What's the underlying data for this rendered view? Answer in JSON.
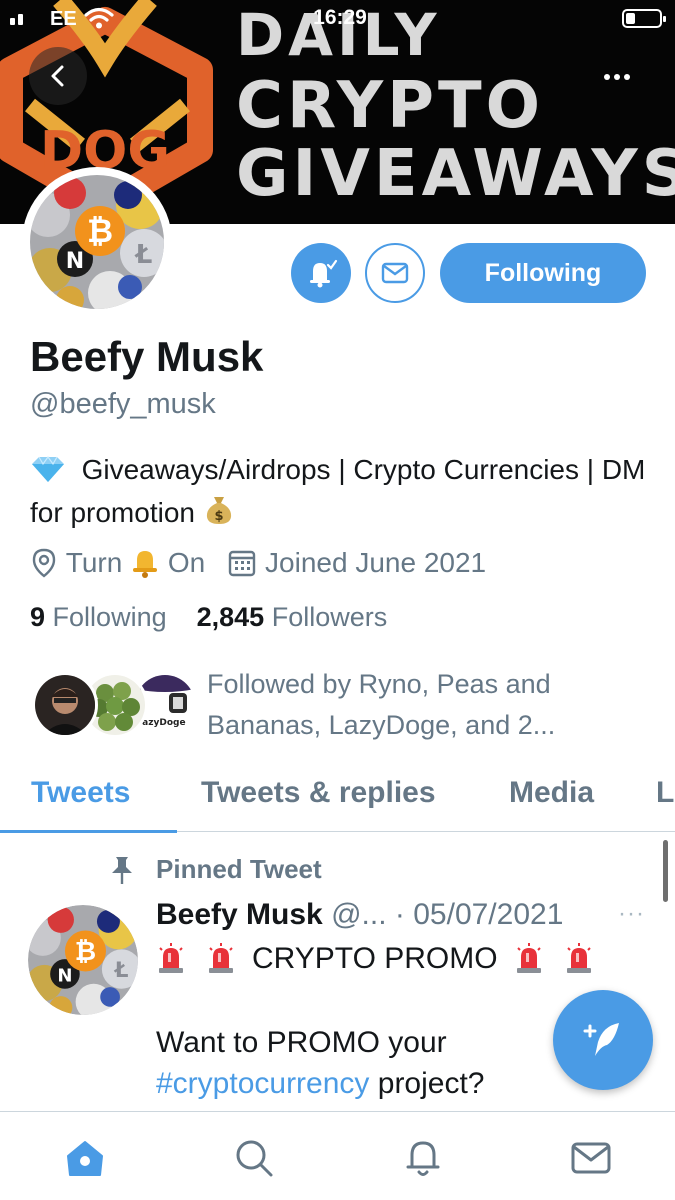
{
  "status_bar": {
    "carrier": "EE",
    "time": "16:29"
  },
  "banner": {
    "line1": "DAILY",
    "line2": "CRYPTO",
    "line3": "GIVEAWAYS",
    "logo_text": "DOG",
    "bg_color": "#050505",
    "text_color": "#d9d9d9",
    "logo_color": "#e0622b"
  },
  "profile": {
    "name": "Beefy Musk",
    "handle": "@beefy_musk",
    "bio_part1": "Giveaways/Airdrops | Crypto Currencies | DM for promotion",
    "location_before": "Turn",
    "location_after": "On",
    "joined": "Joined June 2021",
    "following_count": "9",
    "following_label": "Following",
    "followers_count": "2,845",
    "followers_label": "Followers",
    "followed_by": "Followed by Ryno, Peas and Bananas, LazyDoge, and 2..."
  },
  "actions": {
    "following_label": "Following",
    "notification_icon": "bell-check-icon",
    "message_icon": "envelope-icon"
  },
  "tabs": [
    "Tweets",
    "Tweets & replies",
    "Media",
    "L"
  ],
  "active_tab": "Tweets",
  "tweet": {
    "pinned_label": "Pinned Tweet",
    "author": "Beefy Musk",
    "handle_truncated": "@...",
    "separator": "·",
    "date": "05/07/2021",
    "more": "···",
    "line1_text": "CRYPTO PROMO",
    "line2": "Want to PROMO your",
    "hashtag": "#cryptocurrency",
    "line3_rest": " project?"
  },
  "colors": {
    "accent": "#4a9be5",
    "secondary_text": "#657786",
    "primary_text": "#14171a",
    "divider": "#ccd6dd"
  },
  "bottom_nav": [
    "home-icon",
    "search-icon",
    "notifications-icon",
    "messages-icon"
  ]
}
